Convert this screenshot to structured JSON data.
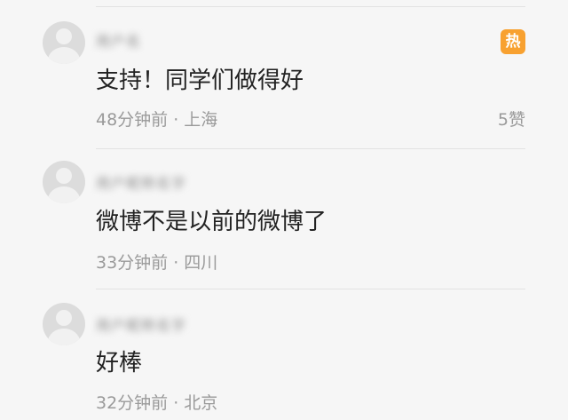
{
  "colors": {
    "background": "#f6f6f6",
    "hot_badge": "#f8a130",
    "text": "#222222",
    "meta": "#9a9a9a"
  },
  "comments": [
    {
      "username": "用户名",
      "text": "支持！同学们做得好",
      "meta": "48分钟前 · 上海",
      "likes": "5赞",
      "badge": "热"
    },
    {
      "username": "用户昵称名字",
      "text": "微博不是以前的微博了",
      "meta": "33分钟前 · 四川"
    },
    {
      "username": "用户昵称名字",
      "text": "好棒",
      "meta": "32分钟前 · 北京"
    }
  ]
}
